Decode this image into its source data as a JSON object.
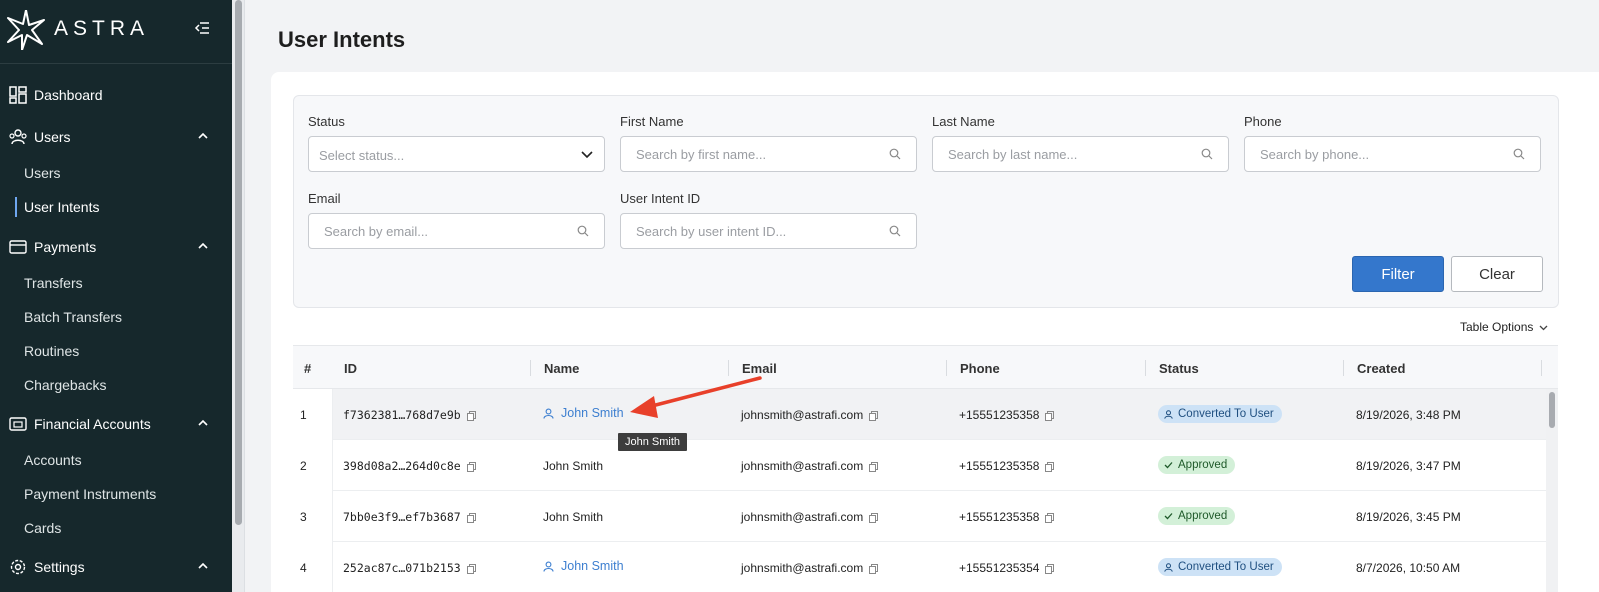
{
  "brand": {
    "name": "ASTRA"
  },
  "sidebar": {
    "dashboard": "Dashboard",
    "users_section": "Users",
    "users_items": [
      "Users",
      "User Intents"
    ],
    "payments_section": "Payments",
    "payments_items": [
      "Transfers",
      "Batch Transfers",
      "Routines",
      "Chargebacks"
    ],
    "financial_section": "Financial Accounts",
    "financial_items": [
      "Accounts",
      "Payment Instruments",
      "Cards"
    ],
    "settings_section": "Settings",
    "active_item": "User Intents"
  },
  "page": {
    "title": "User Intents"
  },
  "filters": {
    "status_label": "Status",
    "status_placeholder": "Select status...",
    "first_name_label": "First Name",
    "first_name_placeholder": "Search by first name...",
    "last_name_label": "Last Name",
    "last_name_placeholder": "Search by last name...",
    "phone_label": "Phone",
    "phone_placeholder": "Search by phone...",
    "email_label": "Email",
    "email_placeholder": "Search by email...",
    "intent_id_label": "User Intent ID",
    "intent_id_placeholder": "Search by user intent ID...",
    "filter_button": "Filter",
    "clear_button": "Clear"
  },
  "table_options": "Table Options",
  "table": {
    "columns": [
      "#",
      "ID",
      "Name",
      "Email",
      "Phone",
      "Status",
      "Created"
    ],
    "rows": [
      {
        "num": "1",
        "id": "f7362381…768d7e9b",
        "name": "John Smith",
        "linked": true,
        "email": "johnsmith@astrafi.com",
        "phone": "+15551235358",
        "status": "Converted To User",
        "status_kind": "converted",
        "created": "8/19/2026, 3:48 PM"
      },
      {
        "num": "2",
        "id": "398d08a2…264d0c8e",
        "name": "John Smith",
        "linked": false,
        "email": "johnsmith@astrafi.com",
        "phone": "+15551235358",
        "status": "Approved",
        "status_kind": "approved",
        "created": "8/19/2026, 3:47 PM"
      },
      {
        "num": "3",
        "id": "7bb0e3f9…ef7b3687",
        "name": "John Smith",
        "linked": false,
        "email": "johnsmith@astrafi.com",
        "phone": "+15551235358",
        "status": "Approved",
        "status_kind": "approved",
        "created": "8/19/2026, 3:45 PM"
      },
      {
        "num": "4",
        "id": "252ac87c…071b2153",
        "name": "John Smith",
        "linked": true,
        "email": "johnsmith@astrafi.com",
        "phone": "+15551235354",
        "status": "Converted To User",
        "status_kind": "converted",
        "created": "8/7/2026, 10:50 AM"
      }
    ]
  },
  "tooltip": "John Smith",
  "colors": {
    "sidebar_bg": "#16282c",
    "accent": "#3477cc",
    "link": "#3d7fd0",
    "annotation_arrow": "#e8402a"
  }
}
